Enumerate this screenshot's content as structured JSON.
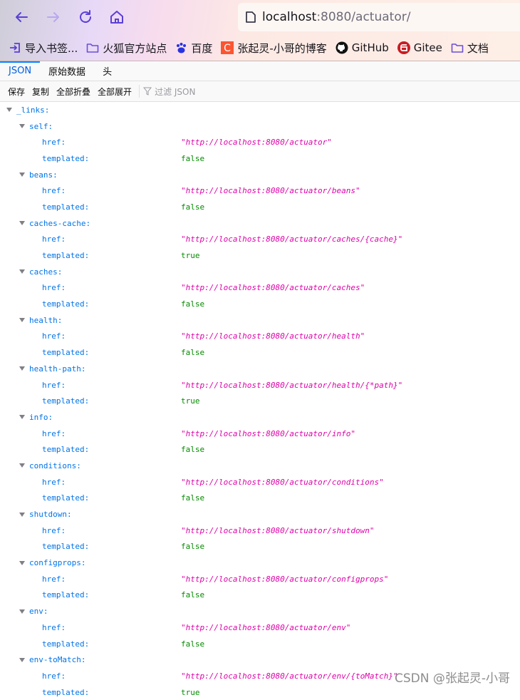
{
  "browser": {
    "nav": {
      "back": "back-arrow",
      "forward": "forward-arrow",
      "reload": "reload",
      "home": "home"
    },
    "url_host": "localhost",
    "url_rest": ":8080/actuator/",
    "bookmarks": [
      {
        "label": "导入书签...",
        "icon": "import-icon"
      },
      {
        "label": "火狐官方站点",
        "icon": "folder-icon"
      },
      {
        "label": "百度",
        "icon": "baidu-icon"
      },
      {
        "label": "张起灵-小哥的博客",
        "icon": "csdn-icon"
      },
      {
        "label": "GitHub",
        "icon": "github-icon"
      },
      {
        "label": "Gitee",
        "icon": "gitee-icon"
      },
      {
        "label": "文档",
        "icon": "folder-icon"
      }
    ]
  },
  "viewer": {
    "tabs": [
      "JSON",
      "原始数据",
      "头"
    ],
    "toolbar": {
      "save": "保存",
      "copy": "复制",
      "collapse_all": "全部折叠",
      "expand_all": "全部展开",
      "filter_placeholder": "过滤 JSON"
    }
  },
  "json": {
    "root_key": "_links:",
    "entries": [
      {
        "name": "self:",
        "href": "\"http://localhost:8080/actuator\"",
        "templated": "false"
      },
      {
        "name": "beans:",
        "href": "\"http://localhost:8080/actuator/beans\"",
        "templated": "false"
      },
      {
        "name": "caches-cache:",
        "href": "\"http://localhost:8080/actuator/caches/{cache}\"",
        "templated": "true"
      },
      {
        "name": "caches:",
        "href": "\"http://localhost:8080/actuator/caches\"",
        "templated": "false"
      },
      {
        "name": "health:",
        "href": "\"http://localhost:8080/actuator/health\"",
        "templated": "false"
      },
      {
        "name": "health-path:",
        "href": "\"http://localhost:8080/actuator/health/{*path}\"",
        "templated": "true"
      },
      {
        "name": "info:",
        "href": "\"http://localhost:8080/actuator/info\"",
        "templated": "false"
      },
      {
        "name": "conditions:",
        "href": "\"http://localhost:8080/actuator/conditions\"",
        "templated": "false"
      },
      {
        "name": "shutdown:",
        "href": "\"http://localhost:8080/actuator/shutdown\"",
        "templated": "false"
      },
      {
        "name": "configprops:",
        "href": "\"http://localhost:8080/actuator/configprops\"",
        "templated": "false"
      },
      {
        "name": "env:",
        "href": "\"http://localhost:8080/actuator/env\"",
        "templated": "false"
      },
      {
        "name": "env-toMatch:",
        "href": "\"http://localhost:8080/actuator/env/{toMatch}\"",
        "templated": "true"
      }
    ],
    "href_label": "href:",
    "templated_label": "templated:"
  },
  "watermark": "CSDN @张起灵-小哥"
}
